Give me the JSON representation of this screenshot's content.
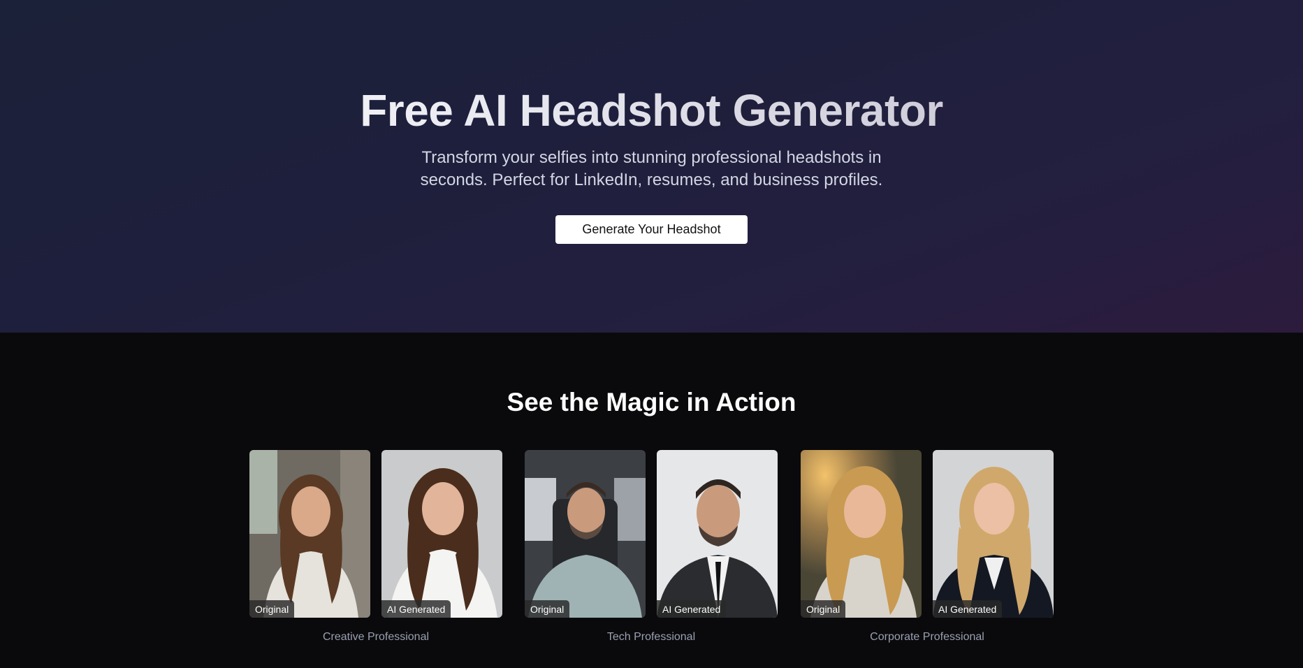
{
  "hero": {
    "title": "Free AI Headshot Generator",
    "subtitle_line1": "Transform your selfies into stunning professional headshots in",
    "subtitle_line2": "seconds. Perfect for LinkedIn, resumes, and business profiles.",
    "cta_label": "Generate Your Headshot"
  },
  "showcase": {
    "title": "See the Magic in Action",
    "examples": [
      {
        "original_label": "Original",
        "generated_label": "AI Generated",
        "caption": "Creative Professional"
      },
      {
        "original_label": "Original",
        "generated_label": "AI Generated",
        "caption": "Tech Professional"
      },
      {
        "original_label": "Original",
        "generated_label": "AI Generated",
        "caption": "Corporate Professional"
      }
    ]
  },
  "colors": {
    "hero_gradient_start": "#1b2138",
    "hero_gradient_end": "#2c1b3d",
    "page_background": "#0a0a0c",
    "cta_background": "#ffffff",
    "caption_text": "#9aa0b2"
  }
}
